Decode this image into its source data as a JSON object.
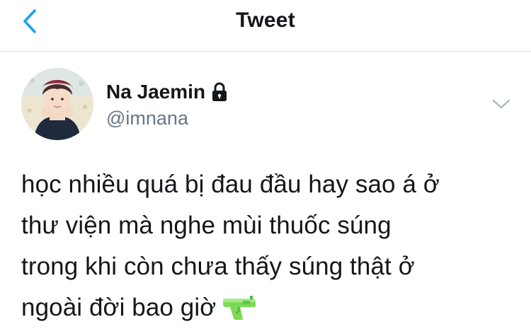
{
  "header": {
    "title": "Tweet",
    "back_icon": "chevron-left-icon",
    "accent_color": "#1da1f2"
  },
  "tweet": {
    "author": {
      "display_name": "Na Jaemin",
      "handle": "@imnana",
      "protected_icon": "lock-icon"
    },
    "menu_icon": "chevron-down-icon",
    "text_lines": [
      "học nhiều quá bị đau đầu hay sao á ở",
      "thư viện mà nghe mùi thuốc súng",
      "trong khi còn chưa thấy súng thật ở",
      "ngoài đời bao giờ"
    ],
    "emoji": "water-pistol-icon"
  }
}
